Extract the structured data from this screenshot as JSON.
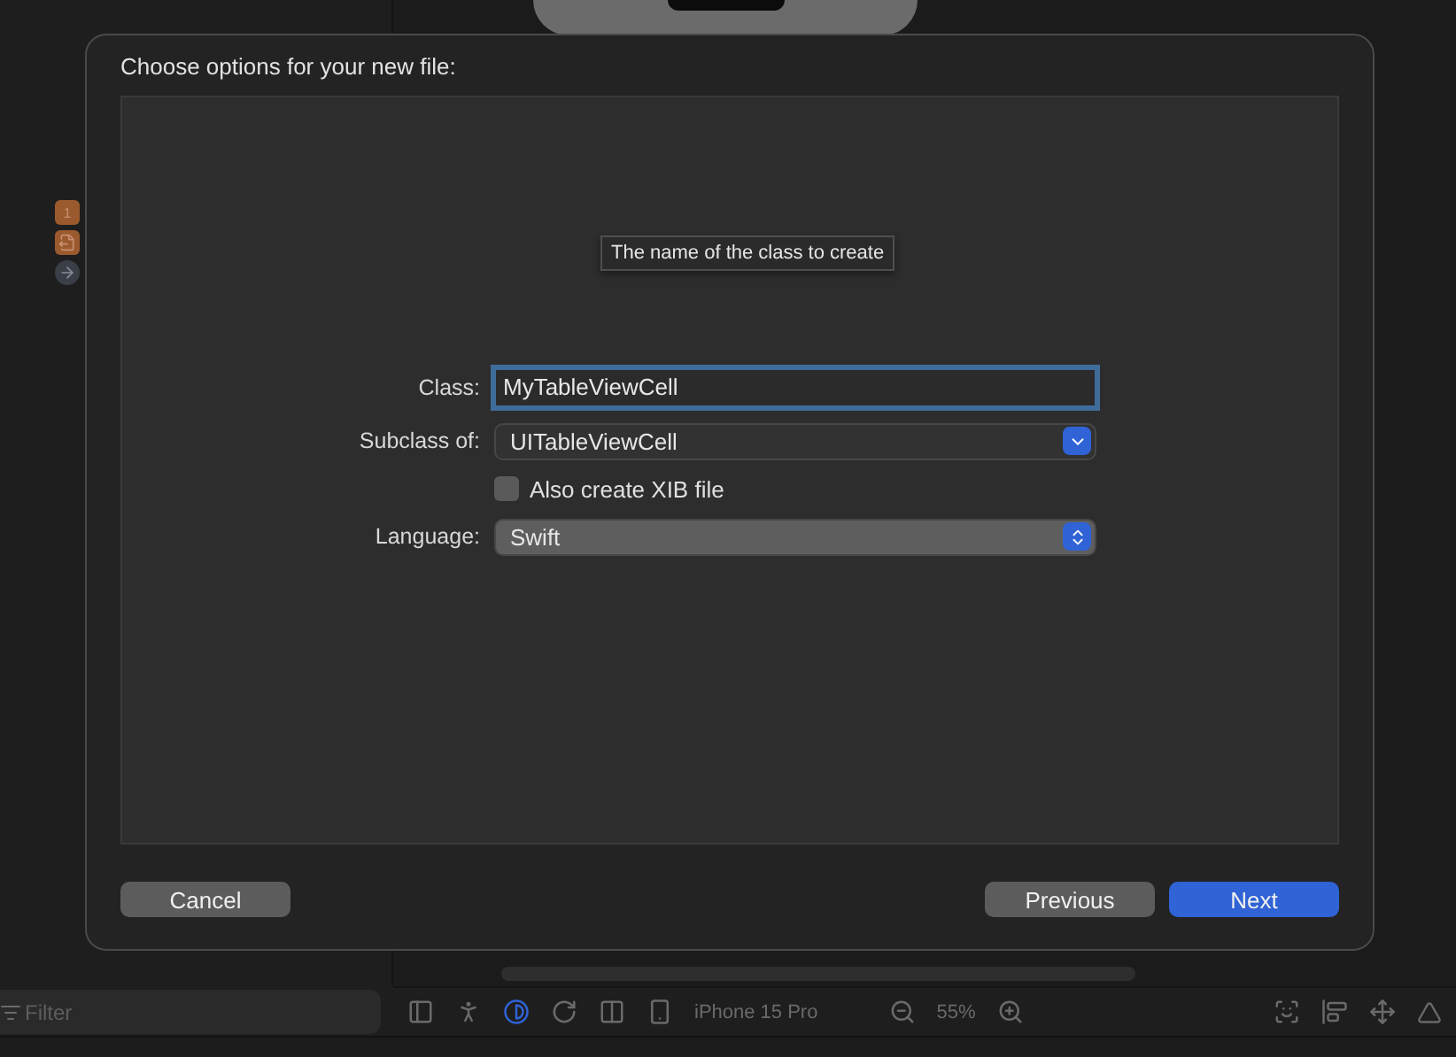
{
  "sidebar": {
    "badges": [
      {
        "kind": "count",
        "text": "1",
        "color": "#9a5a2e"
      },
      {
        "kind": "document",
        "color": "#9a5a2e"
      },
      {
        "kind": "arrow",
        "color": "#3a3e46"
      }
    ],
    "filter": {
      "placeholder": "Filter"
    }
  },
  "bottom_bar": {
    "device": "iPhone 15 Pro",
    "zoom": "55%"
  },
  "dialog": {
    "title": "Choose options for your new file:",
    "tooltip": "The name of the class to create",
    "fields": [
      {
        "kind": "text",
        "label": "Class:",
        "value": "MyTableViewCell",
        "focused": true
      },
      {
        "kind": "popup",
        "label": "Subclass of:",
        "value": "UITableViewCell"
      },
      {
        "kind": "checkbox",
        "label": "Also create XIB file",
        "checked": false
      },
      {
        "kind": "select",
        "label": "Language:",
        "value": "Swift"
      }
    ],
    "buttons": [
      {
        "label": "Cancel",
        "primary": false
      },
      {
        "label": "Previous",
        "primary": false
      },
      {
        "label": "Next",
        "primary": true
      }
    ]
  }
}
